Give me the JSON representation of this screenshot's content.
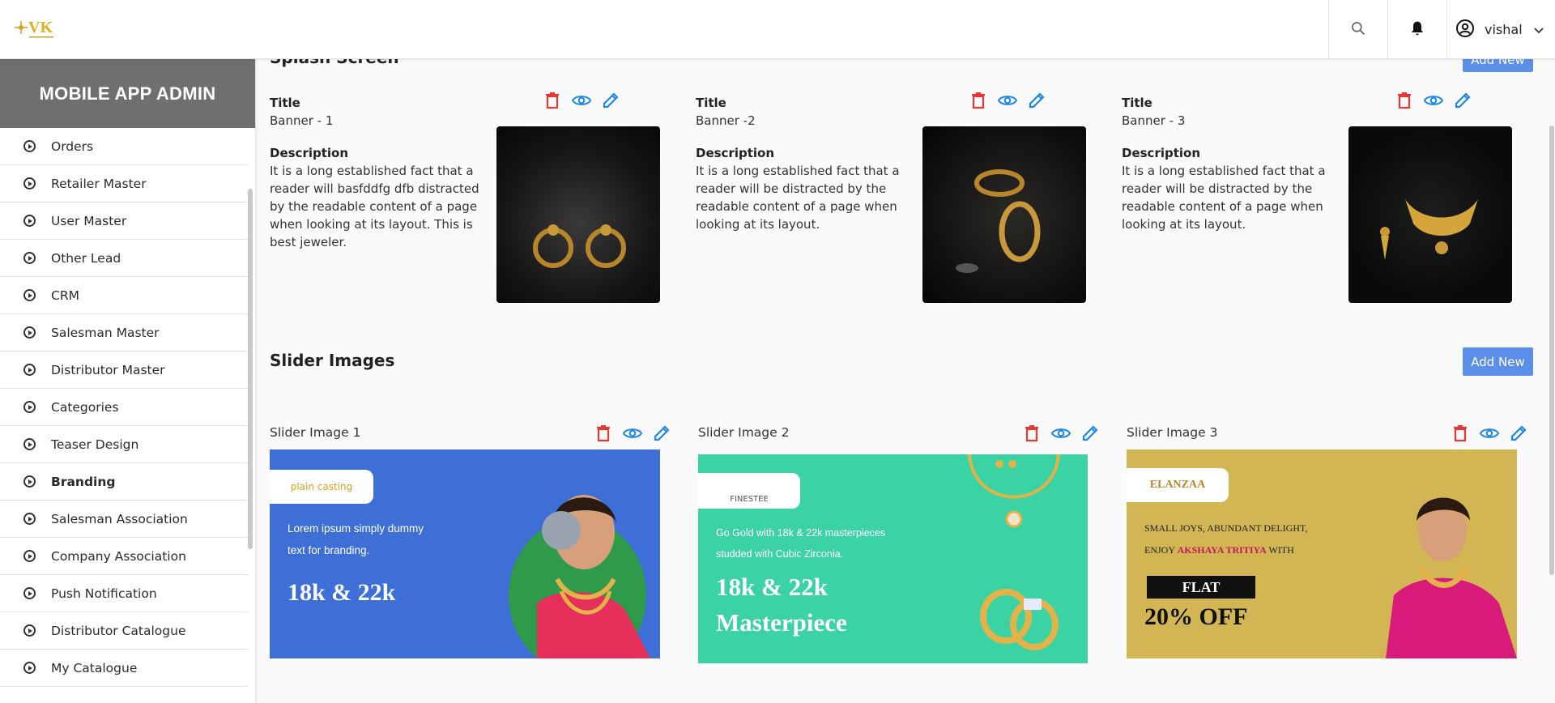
{
  "header": {
    "logo_text": "VK",
    "user_name": "vishal"
  },
  "sidebar": {
    "title": "MOBILE APP ADMIN",
    "items": [
      {
        "label": "Orders"
      },
      {
        "label": "Retailer Master"
      },
      {
        "label": "User Master"
      },
      {
        "label": "Other Lead"
      },
      {
        "label": "CRM"
      },
      {
        "label": "Salesman Master"
      },
      {
        "label": "Distributor Master"
      },
      {
        "label": "Categories"
      },
      {
        "label": "Teaser Design"
      },
      {
        "label": "Branding",
        "active": true
      },
      {
        "label": "Salesman Association"
      },
      {
        "label": "Company Association"
      },
      {
        "label": "Push Notification"
      },
      {
        "label": "Distributor Catalogue"
      },
      {
        "label": "My Catalogue"
      }
    ]
  },
  "splash": {
    "section_title": "Splash Screen",
    "add_label": "Add New",
    "title_label": "Title",
    "description_label": "Description",
    "banners": [
      {
        "title": "Banner - 1",
        "description": "It is a long established fact that a reader will basfddfg dfb distracted by the readable content of a page when looking at its layout. This is best jeweler."
      },
      {
        "title": "Banner -2",
        "description": "It is a long established fact that a reader will be distracted by the readable content of a page when looking at its layout."
      },
      {
        "title": "Banner - 3",
        "description": "It is a long established fact that a reader will be distracted by the readable content of a page when looking at its layout."
      }
    ]
  },
  "slider": {
    "section_title": "Slider Images",
    "add_label": "Add New",
    "items": [
      {
        "title": "Slider Image 1",
        "brand": "plain casting",
        "line1": "Lorem ipsum simply dummy",
        "line2": "text for branding.",
        "big": "18k & 22k"
      },
      {
        "title": "Slider Image 2",
        "brand": "FINESTEE",
        "line1": "Go Gold with 18k & 22k masterpieces",
        "line2": "studded with Cubic Zirconia.",
        "big": "18k & 22k",
        "big2": "Masterpiece"
      },
      {
        "title": "Slider Image 3",
        "brand": "ELANZAA",
        "line1": "SMALL JOYS, ABUNDANT DELIGHT,",
        "line2a": "ENJOY ",
        "highlight": "AKSHAYA TRITIYA",
        "line2b": " WITH",
        "flat": "FLAT",
        "off": "20% OFF"
      }
    ]
  },
  "colors": {
    "delete": "#e53935",
    "view": "#1e88e5",
    "edit": "#1e88e5",
    "button": "#5b8fea"
  }
}
